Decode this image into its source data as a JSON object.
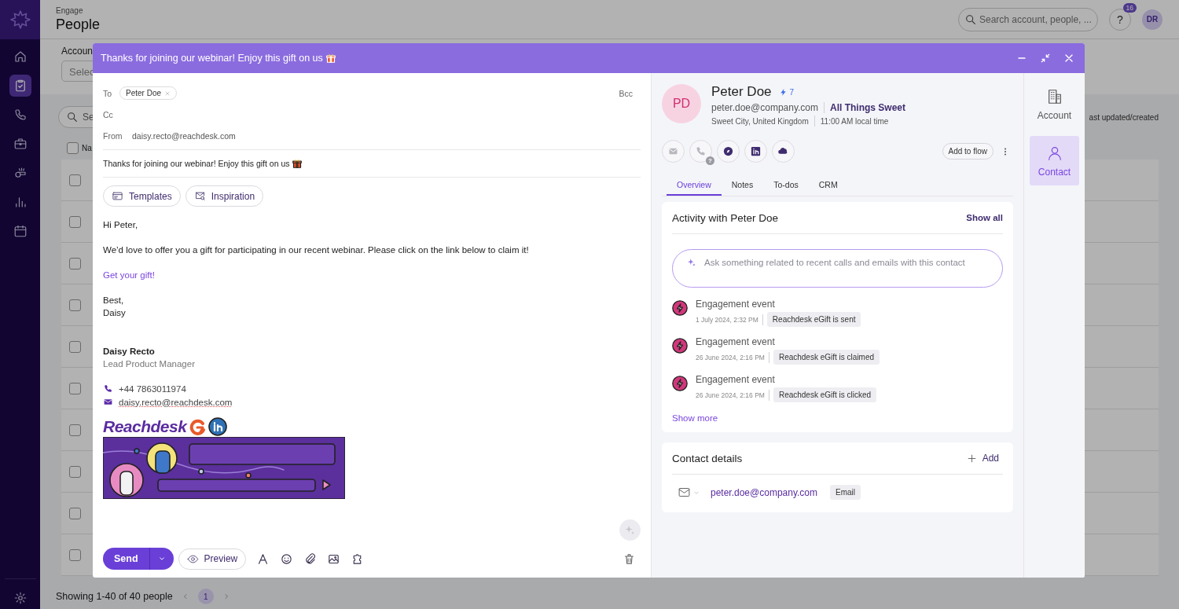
{
  "nav": {
    "items": [
      {
        "selected": false
      },
      {
        "selected": true
      },
      {
        "selected": false
      },
      {
        "selected": false
      },
      {
        "selected": false
      },
      {
        "selected": false
      },
      {
        "selected": false
      }
    ]
  },
  "header": {
    "section": "Engage",
    "title": "People",
    "search_placeholder": "Search account, people, ...",
    "help": "?",
    "notification_count": "16",
    "avatar": "DR"
  },
  "filters": {
    "label": "Accoun",
    "select_placeholder": "Selec"
  },
  "table": {
    "search_placeholder": "Se",
    "column_1": "Na",
    "header_checked": false,
    "sort_label": "ast updated/created",
    "rows": [
      {
        "checked": false
      },
      {
        "checked": false
      },
      {
        "checked": false
      },
      {
        "checked": false
      },
      {
        "checked": false
      },
      {
        "checked": false
      },
      {
        "checked": false
      },
      {
        "checked": false
      },
      {
        "checked": false
      },
      {
        "checked": false
      }
    ]
  },
  "pagination": {
    "summary": "Showing 1-40 of 40 people",
    "pages": [
      {
        "label": "1",
        "selected": true
      }
    ]
  },
  "modal": {
    "title": "Thanks for joining our webinar! Enjoy this gift on us",
    "compose": {
      "to_label": "To",
      "recipients": [
        {
          "name": "Peter Doe"
        }
      ],
      "bcc": "Bcc",
      "cc_label": "Cc",
      "from_label": "From",
      "from": "daisy.recto@reachdesk.com",
      "subject": "Thanks for joining our webinar! Enjoy this gift on us",
      "tools": [
        {
          "label": "Templates"
        },
        {
          "label": "Inspiration"
        }
      ],
      "greeting": "Hi Peter,",
      "paragraph": "We’d love to offer you a gift for participating in our recent webinar. Please click on the link below to claim it!",
      "link": "Get your gift!",
      "closing": [
        "Best,",
        "Daisy"
      ],
      "signature": {
        "name": "Daisy Recto",
        "role": "Lead Product Manager",
        "phone": "+44 7863011974",
        "email": "daisy.recto@reachdesk.com",
        "logo": "Reachdesk"
      },
      "send": "Send",
      "preview": "Preview"
    },
    "contact": {
      "initials": "PD",
      "name": "Peter Doe",
      "score": "7",
      "email": "peter.doe@company.com",
      "company": "All Things Sweet",
      "location": "Sweet City, United Kingdom",
      "local_time": "11:00 AM local time",
      "actions": [
        {
          "disabled": true
        },
        {
          "disabled": true,
          "badge": "?"
        },
        {
          "disabled": false
        },
        {
          "disabled": false
        },
        {
          "disabled": false
        }
      ],
      "add_to_flow": "Add to flow",
      "tabs": [
        {
          "label": "Overview",
          "selected": true
        },
        {
          "label": "Notes",
          "selected": false
        },
        {
          "label": "To-dos",
          "selected": false
        },
        {
          "label": "CRM",
          "selected": false
        }
      ],
      "activity": {
        "title": "Activity with Peter Doe",
        "show_all": "Show all",
        "ask_placeholder": "Ask something related to recent calls and emails with this contact",
        "events": [
          {
            "title": "Engagement event",
            "time": "1 July 2024, 2:32 PM",
            "tag": "Reachdesk eGift is sent"
          },
          {
            "title": "Engagement event",
            "time": "26 June 2024, 2:16 PM",
            "tag": "Reachdesk eGift is claimed"
          },
          {
            "title": "Engagement event",
            "time": "26 June 2024, 2:16 PM",
            "tag": "Reachdesk eGift is clicked"
          }
        ],
        "show_more": "Show more"
      },
      "details": {
        "title": "Contact details",
        "add": "Add",
        "items": [
          {
            "value": "peter.doe@company.com",
            "tag": "Email"
          }
        ]
      }
    },
    "side_tabs": [
      {
        "label": "Account",
        "selected": false
      },
      {
        "label": "Contact",
        "selected": true
      }
    ]
  }
}
